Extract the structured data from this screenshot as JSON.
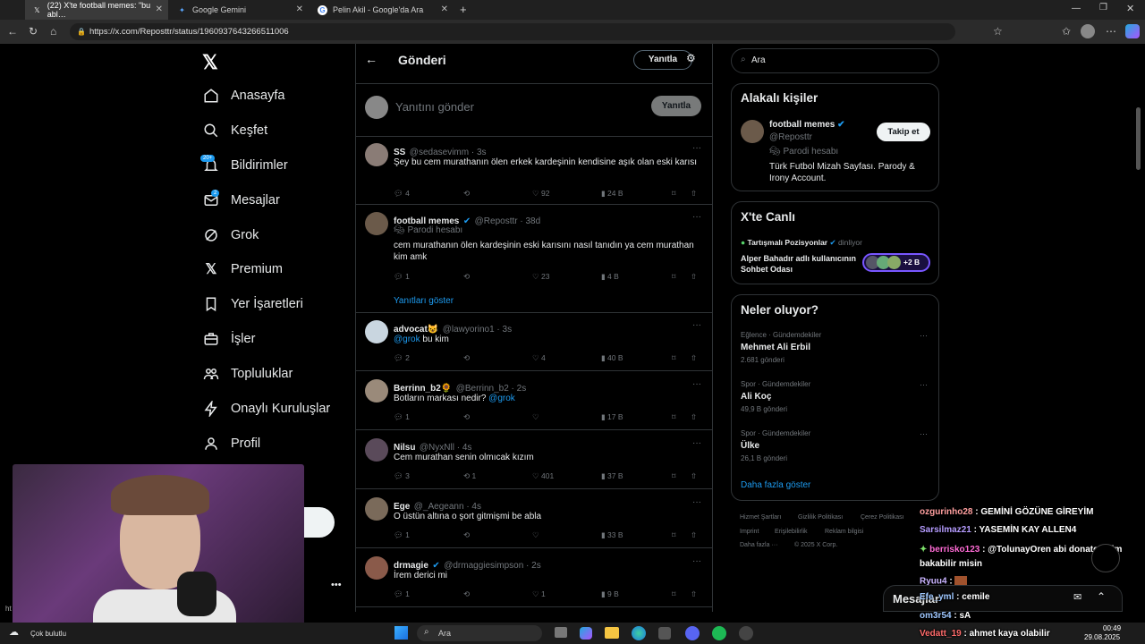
{
  "browser": {
    "tabs": [
      {
        "title": "(22) X'te football memes: \"bu abl…"
      },
      {
        "title": "Google Gemini"
      },
      {
        "title": "Pelin Akil - Google'da Ara"
      }
    ],
    "url": "https://x.com/Reposttr/status/1960937643266511006"
  },
  "nav": {
    "items": [
      {
        "label": "Anasayfa"
      },
      {
        "label": "Keşfet"
      },
      {
        "label": "Bildirimler",
        "badge": "20+"
      },
      {
        "label": "Mesajlar",
        "badge": "2"
      },
      {
        "label": "Grok"
      },
      {
        "label": "Premium"
      },
      {
        "label": "Yer İşaretleri"
      },
      {
        "label": "İşler"
      },
      {
        "label": "Topluluklar"
      },
      {
        "label": "Onaylı Kuruluşlar"
      },
      {
        "label": "Profil"
      }
    ]
  },
  "header": {
    "title": "Gönderi",
    "reply_button": "Yanıtla"
  },
  "composer": {
    "placeholder": "Yanıtını gönder",
    "button": "Yanıtla"
  },
  "posts": [
    {
      "name": "SS",
      "handle": "@sedasevimm · 3s",
      "text": "Şey bu cem murathanın ölen erkek kardeşinin kendisine aşık olan eski karısı",
      "reply": "4",
      "repost": "",
      "like": "92",
      "views": "24 B"
    },
    {
      "name": "football memes",
      "handle": "@Reposttr · 38d",
      "label": "Parodi hesabı",
      "text": "cem murathanın ölen kardeşinin eski karısını nasıl tanıdın ya cem murathan kim amk",
      "reply": "1",
      "repost": "",
      "like": "23",
      "views": "4 B",
      "show_replies": "Yanıtları göster"
    },
    {
      "name": "advocat😺",
      "handle": "@lawyorino1 · 3s",
      "mention": "@grok",
      "text": " bu kim",
      "reply": "2",
      "repost": "",
      "like": "4",
      "views": "40 B"
    },
    {
      "name": "Berrinn_b2🌻",
      "handle": "@Berrinn_b2 · 2s",
      "text": "Botların markası nedir? ",
      "mention": "@grok",
      "reply": "1",
      "repost": "",
      "like": "",
      "views": "17 B"
    },
    {
      "name": "Nilsu",
      "handle": "@NyxNll · 4s",
      "text": "Cem murathan senin olmıcak kızım",
      "reply": "3",
      "repost": "1",
      "like": "401",
      "views": "37 B"
    },
    {
      "name": "Ege",
      "handle": "@_Aegeann · 4s",
      "text": "O üstün altına o şort gitmişmi be abla",
      "reply": "1",
      "repost": "",
      "like": "",
      "views": "33 B"
    },
    {
      "name": "drmagie",
      "handle": "@drmaggiesimpson · 2s",
      "text": "İrem derici mi",
      "reply": "1",
      "repost": "",
      "like": "1",
      "views": "9 B"
    }
  ],
  "right": {
    "search_placeholder": "Ara",
    "related": {
      "title": "Alakalı kişiler",
      "name": "football memes",
      "handle": "@Reposttr",
      "follow": "Takip et",
      "label": "Parodi hesabı",
      "bio": "Türk Futbol Mizah Sayfası. Parody & Irony Account."
    },
    "live": {
      "title": "X'te Canlı",
      "host": "Tartışmalı Pozisyonlar",
      "status": "dinliyor",
      "room": "Alper Bahadır adlı kullanıcının Sohbet Odası",
      "count": "+2 B"
    },
    "trends": {
      "title": "Neler oluyor?",
      "items": [
        {
          "cat": "Eğlence · Gündemdekiler",
          "name": "Mehmet Ali Erbil",
          "count": "2.681 gönderi"
        },
        {
          "cat": "Spor · Gündemdekiler",
          "name": "Ali Koç",
          "count": "49,9 B gönderi"
        },
        {
          "cat": "Spor · Gündemdekiler",
          "name": "Ülke",
          "count": "26,1 B gönderi"
        }
      ],
      "more": "Daha fazla göster"
    },
    "footer": {
      "links": [
        "Hizmet Şartları",
        "Gizlilik Politikası",
        "Çerez Politikası",
        "Imprint",
        "Erişilebilirlik",
        "Reklam bilgisi",
        "Daha fazla ···",
        "© 2025 X Corp."
      ]
    }
  },
  "chat": [
    {
      "user": "ozgurinho28",
      "msg": "GEMİNİ GÖZÜNE GİREYİM",
      "color": "#ff9f9f"
    },
    {
      "user": "Sarsilmaz21",
      "msg": "YASEMİN KAY ALLEN4",
      "color": "#b59cff"
    },
    {
      "user": "berrisko123",
      "msg": "@TolunayOren abi donate attim bakabilir misin",
      "color": "#ff6bd5"
    },
    {
      "user": "Ryuu4",
      "msg": "",
      "color": "#c9b3ff"
    },
    {
      "user": "Efe_yml",
      "msg": "cemile",
      "color": "#9ec7ff"
    },
    {
      "user": "om3r54",
      "msg": "sA",
      "color": "#9ec7ff"
    },
    {
      "user": "Vedatt_19",
      "msg": "ahmet kaya olabilir",
      "color": "#ff6b6b"
    }
  ],
  "messages_bar": {
    "label": "Mesajlar"
  },
  "taskbar": {
    "weather": "Çok bulutlu",
    "search": "Ara",
    "time": "00:49",
    "date": "29.08.2025"
  }
}
